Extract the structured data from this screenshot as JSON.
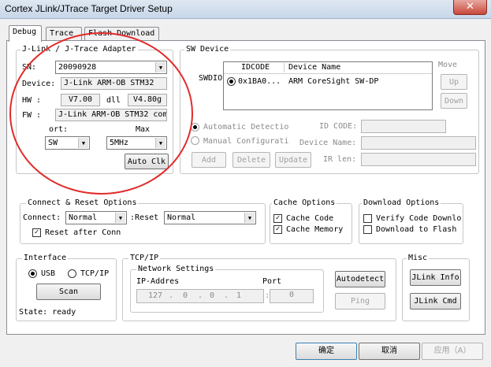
{
  "window": {
    "title": "Cortex JLink/JTrace Target Driver Setup",
    "close_glyph": "✕"
  },
  "tabs": [
    {
      "label": "Debug"
    },
    {
      "label": "Trace"
    },
    {
      "label": "Flash Download"
    }
  ],
  "adapter": {
    "legend": "J-Link / J-Trace Adapter",
    "sn_label": "SN:",
    "sn_value": "20090928",
    "device_label": "Device:",
    "device_value": "J-Link ARM-OB STM32",
    "hw_label": "HW :",
    "hw_value": "V7.00",
    "dll_label": "dll",
    "dll_value": "V4.80g",
    "fw_label": "FW :",
    "fw_value": "J-Link ARM-OB STM32 com",
    "port_label": "ort:",
    "port_value": "SW",
    "max_label": "Max",
    "max_value": "5MHz",
    "auto_clk_label": "Auto Clk"
  },
  "sw_device": {
    "legend": "SW Device",
    "swdio_label": "SWDIO",
    "col_idcode": "IDCODE",
    "col_device": "Device Name",
    "row": {
      "idcode": "0x1BA0...",
      "device": "ARM CoreSight SW-DP"
    },
    "move_label": "Move",
    "up_label": "Up",
    "down_label": "Down",
    "auto_detect_label": "Automatic Detectio",
    "manual_config_label": "Manual Configurati",
    "idcode_label": "ID CODE:",
    "device_name_label": "Device Name:",
    "ir_len_label": "IR len:",
    "add_label": "Add",
    "delete_label": "Delete",
    "update_label": "Update"
  },
  "connect_reset": {
    "legend": "Connect & Reset Options",
    "connect_label": "Connect:",
    "connect_value": "Normal",
    "reset_label": "Reset:",
    "reset_value": "Normal",
    "reset_after_connect_label": "Reset after Conn",
    "reset_after_connect_checked": true
  },
  "cache": {
    "legend": "Cache Options",
    "code_label": "Cache Code",
    "code_checked": true,
    "memory_label": "Cache Memory",
    "memory_checked": true
  },
  "download": {
    "legend": "Download Options",
    "verify_label": "Verify Code Downlo",
    "verify_checked": false,
    "flash_label": "Download to Flash",
    "flash_checked": false
  },
  "interface": {
    "legend": "Interface",
    "usb_label": "USB",
    "usb_selected": true,
    "tcpip_label": "TCP/IP",
    "scan_label": "Scan",
    "state_text": "State: ready"
  },
  "tcpip": {
    "legend": "TCP/IP",
    "network_legend": "Network Settings",
    "ip_label": "IP-Addres",
    "port_label": "Port",
    "ip": [
      "127",
      "0",
      "0",
      "1"
    ],
    "dot": ".",
    "colon": ":",
    "port_value": "0",
    "autodetect_label": "Autodetect",
    "ping_label": "Ping"
  },
  "misc": {
    "legend": "Misc",
    "jlink_info_label": "JLink Info",
    "jlink_cmd_label": "JLink Cmd"
  },
  "footer": {
    "ok_label": "确定",
    "cancel_label": "取消",
    "apply_label": "应用（A）"
  },
  "check_glyph": "✓",
  "dropdown_glyph": "▼",
  "highlight_color": "#e22b2b"
}
